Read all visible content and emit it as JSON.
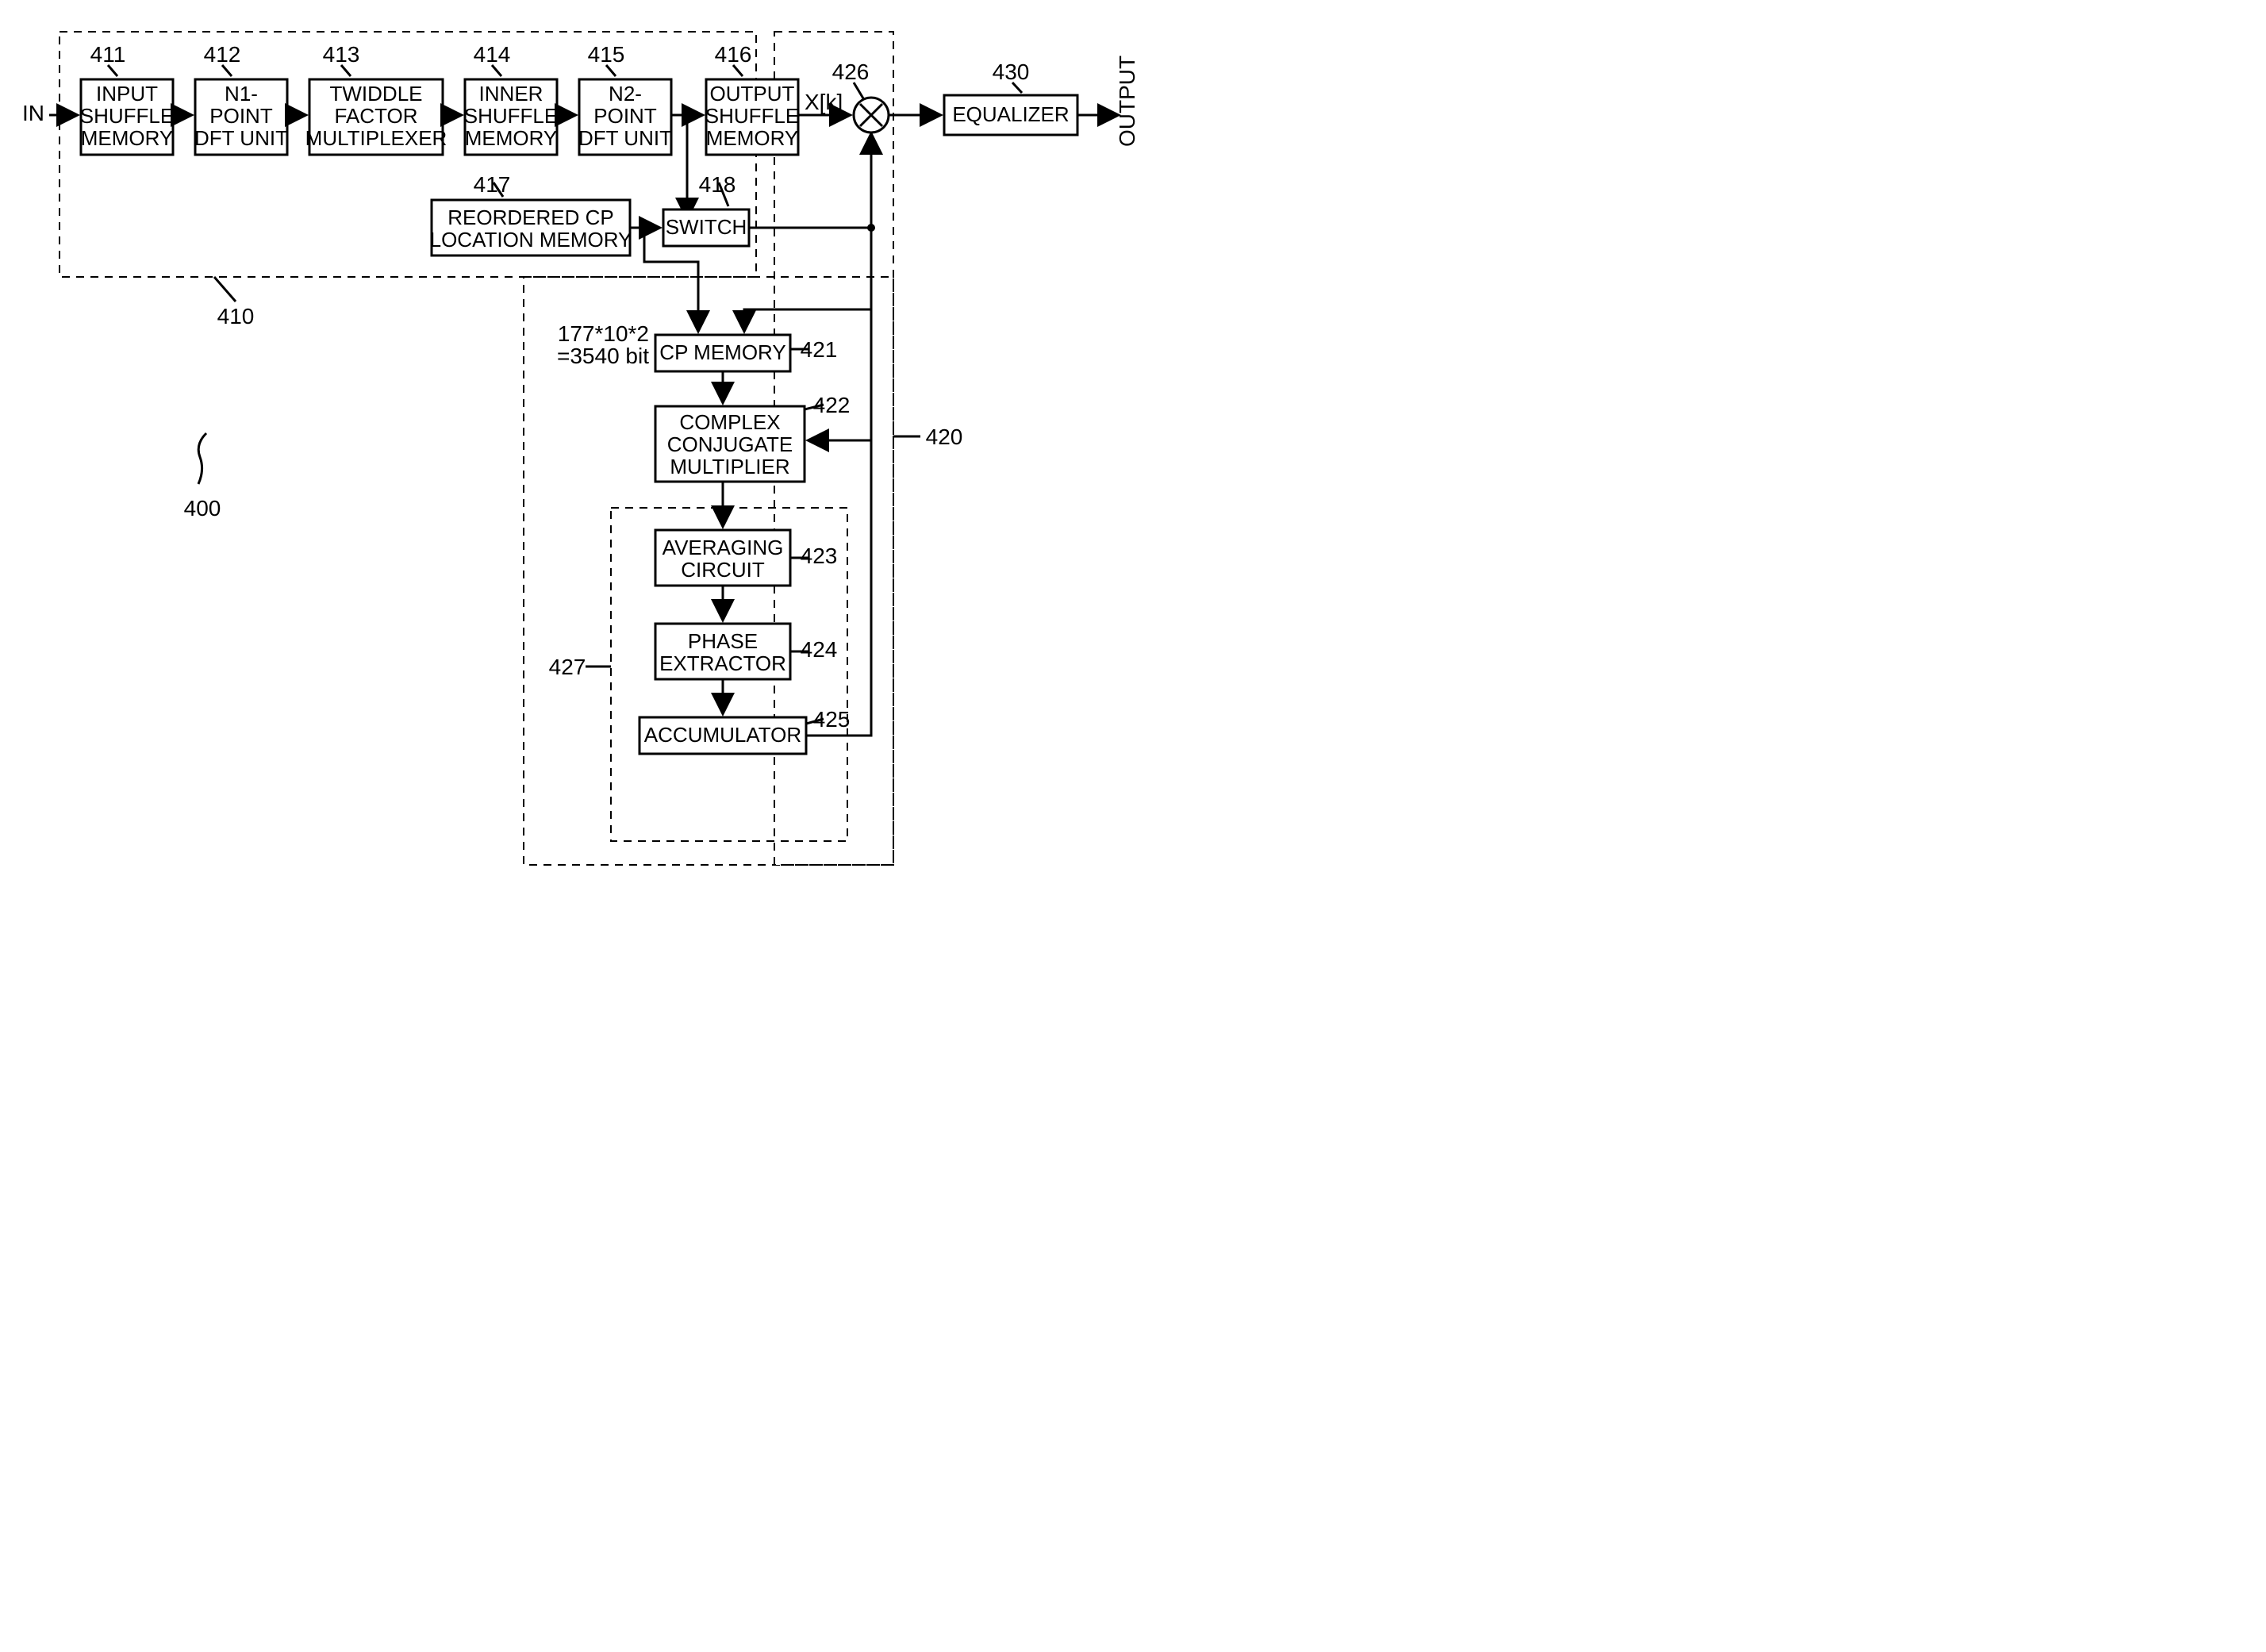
{
  "io": {
    "in": "IN",
    "out": "OUTPUT",
    "xk": "X[k]"
  },
  "figure": {
    "ref_400": "400",
    "ref_410": "410",
    "ref_420": "420",
    "ref_427": "427"
  },
  "blocks": {
    "b411": {
      "l1": "INPUT",
      "l2": "SHUFFLE",
      "l3": "MEMORY",
      "num": "411"
    },
    "b412": {
      "l1": "N1-",
      "l2": "POINT",
      "l3": "DFT UNIT",
      "num": "412"
    },
    "b413": {
      "l1": "TWIDDLE",
      "l2": "FACTOR",
      "l3": "MULTIPLEXER",
      "num": "413"
    },
    "b414": {
      "l1": "INNER",
      "l2": "SHUFFLE",
      "l3": "MEMORY",
      "num": "414"
    },
    "b415": {
      "l1": "N2-",
      "l2": "POINT",
      "l3": "DFT UNIT",
      "num": "415"
    },
    "b416": {
      "l1": "OUTPUT",
      "l2": "SHUFFLE",
      "l3": "MEMORY",
      "num": "416"
    },
    "b417": {
      "l1": "REORDERED CP",
      "l2": "LOCATION MEMORY",
      "num": "417"
    },
    "b418": {
      "l1": "SWITCH",
      "num": "418"
    },
    "b421": {
      "l1": "CP MEMORY",
      "num": "421",
      "note1": "177*10*2",
      "note2": "=3540 bit"
    },
    "b422": {
      "l1": "COMPLEX",
      "l2": "CONJUGATE",
      "l3": "MULTIPLIER",
      "num": "422"
    },
    "b423": {
      "l1": "AVERAGING",
      "l2": "CIRCUIT",
      "num": "423"
    },
    "b424": {
      "l1": "PHASE",
      "l2": "EXTRACTOR",
      "num": "424"
    },
    "b425": {
      "l1": "ACCUMULATOR",
      "num": "425"
    },
    "b426": {
      "num": "426"
    },
    "b430": {
      "l1": "EQUALIZER",
      "num": "430"
    }
  }
}
